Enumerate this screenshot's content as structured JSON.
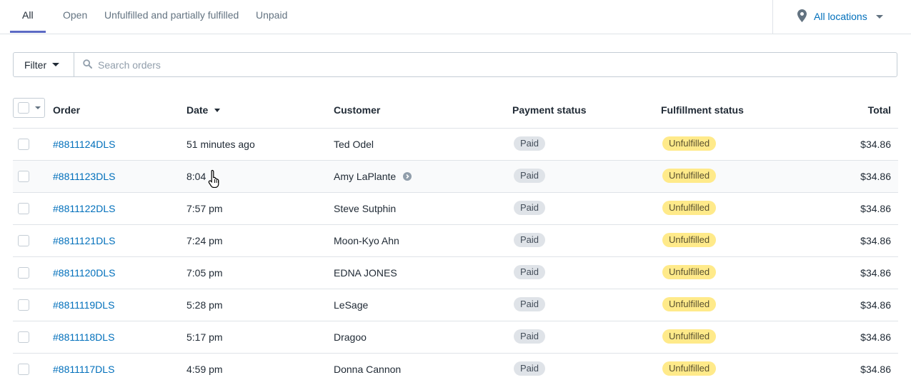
{
  "tabs": [
    {
      "label": "All",
      "active": true
    },
    {
      "label": "Open",
      "active": false
    },
    {
      "label": "Unfulfilled and partially fulfilled",
      "active": false
    },
    {
      "label": "Unpaid",
      "active": false
    }
  ],
  "location": {
    "label": "All locations",
    "icon": "location-pin-icon"
  },
  "filter": {
    "label": "Filter"
  },
  "search": {
    "placeholder": "Search orders",
    "value": ""
  },
  "table": {
    "columns": {
      "order": "Order",
      "date": "Date",
      "customer": "Customer",
      "payment": "Payment status",
      "fulfillment": "Fulfillment status",
      "total": "Total"
    },
    "sort_column": "date",
    "rows": [
      {
        "order": "#8811124DLS",
        "date": "51 minutes ago",
        "customer": "Ted Odel",
        "payment": "Paid",
        "fulfillment": "Unfulfilled",
        "total": "$34.86"
      },
      {
        "order": "#8811123DLS",
        "date": "8:04",
        "customer": "Amy LaPlante",
        "payment": "Paid",
        "fulfillment": "Unfulfilled",
        "total": "$34.86"
      },
      {
        "order": "#8811122DLS",
        "date": "7:57 pm",
        "customer": "Steve Sutphin",
        "payment": "Paid",
        "fulfillment": "Unfulfilled",
        "total": "$34.86"
      },
      {
        "order": "#8811121DLS",
        "date": "7:24 pm",
        "customer": "Moon-Kyo Ahn",
        "payment": "Paid",
        "fulfillment": "Unfulfilled",
        "total": "$34.86"
      },
      {
        "order": "#8811120DLS",
        "date": "7:05 pm",
        "customer": "EDNA JONES",
        "payment": "Paid",
        "fulfillment": "Unfulfilled",
        "total": "$34.86"
      },
      {
        "order": "#8811119DLS",
        "date": "5:28 pm",
        "customer": "LeSage",
        "payment": "Paid",
        "fulfillment": "Unfulfilled",
        "total": "$34.86"
      },
      {
        "order": "#8811118DLS",
        "date": "5:17 pm",
        "customer": "Dragoo",
        "payment": "Paid",
        "fulfillment": "Unfulfilled",
        "total": "$34.86"
      },
      {
        "order": "#8811117DLS",
        "date": "4:59 pm",
        "customer": "Donna Cannon",
        "payment": "Paid",
        "fulfillment": "Unfulfilled",
        "total": "$34.86"
      }
    ]
  },
  "colors": {
    "link": "#006fbb",
    "tab_underline": "#5c6ac4",
    "paid_badge": "#dfe3e8",
    "unfulfilled_badge": "#ffea8a"
  }
}
